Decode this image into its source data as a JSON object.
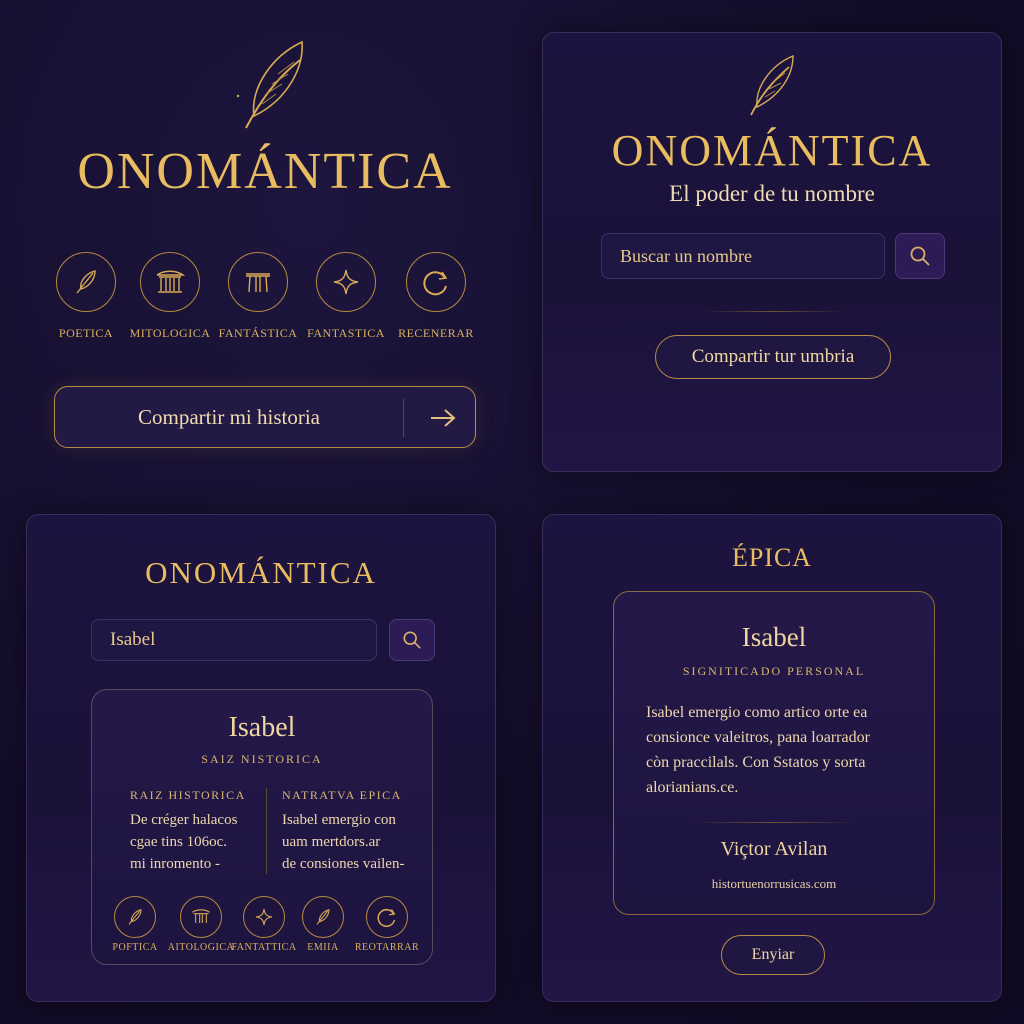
{
  "colors": {
    "gold": "#e9bd5f",
    "background": "#150f2e",
    "panel": "#1c1440",
    "accent_purple": "#2d1b55"
  },
  "panel_a": {
    "brand": "ONOMÁNTICA",
    "modes": [
      {
        "label": "POETICA",
        "icon": "quill-icon"
      },
      {
        "label": "MITOLOGICA",
        "icon": "temple-icon"
      },
      {
        "label": "FANTÁSTICA",
        "icon": "portal-icon"
      },
      {
        "label": "FANTASTICA",
        "icon": "sparkle-icon"
      },
      {
        "label": "RECENERAR",
        "icon": "refresh-icon"
      }
    ],
    "share_label": "Compartir mi historia",
    "share_icon": "arrow-right-icon"
  },
  "panel_b": {
    "brand": "ONOMÁNTICA",
    "tagline": "El poder de tu nombre",
    "search": {
      "placeholder": "Buscar un nombre",
      "icon": "search-icon"
    },
    "share_label": "Compartir tur umbria"
  },
  "panel_c": {
    "brand": "ONOMÁNTICA",
    "search": {
      "value": "Isabel",
      "icon": "search-icon"
    },
    "result": {
      "name": "Isabel",
      "subtitle": "SAIZ NISTORICA",
      "columns": [
        {
          "heading": "RAIZ HISTORICA",
          "text": [
            "De créger halacos",
            "cgae tins 106oc.",
            "mi inromento -"
          ]
        },
        {
          "heading": "NATRATVA EPICA",
          "text": [
            "Isabel emergio con",
            "uam mertdors.ar",
            "de consiones vailen-"
          ]
        }
      ],
      "modes": [
        {
          "label": "POFTICA",
          "icon": "quill-icon"
        },
        {
          "label": "AITOLOGICA",
          "icon": "temple-icon"
        },
        {
          "label": "FANTATTICA",
          "icon": "sparkle-icon"
        },
        {
          "label": "EMIIA",
          "icon": "quill-icon"
        },
        {
          "label": "REOTARRAR",
          "icon": "refresh-icon"
        }
      ]
    }
  },
  "panel_d": {
    "heading": "ÉPICA",
    "card": {
      "name": "Isabel",
      "subtitle": "SIGNITICADO PERSONAL",
      "body": [
        "Isabel emergio como artico orte ea",
        "consionce valeitros, pana loarrador",
        "còn praccilals. Con Sstatos y sorta",
        "alorianians.ce."
      ],
      "author": "Viçtor Avilan",
      "website": "histortuenorrusicas.com"
    },
    "send_label": "Enyiar"
  }
}
